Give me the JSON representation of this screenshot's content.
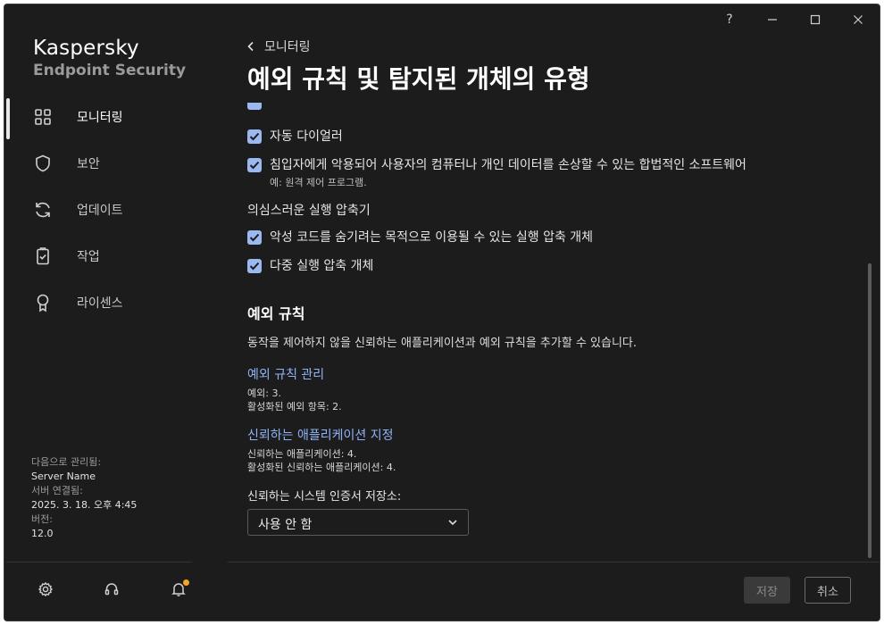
{
  "app": {
    "brand_line1": "Kaspersky",
    "brand_line2": "Endpoint Security"
  },
  "window_controls": {
    "help": "?",
    "icons": [
      "minimize-icon",
      "maximize-icon",
      "close-icon"
    ]
  },
  "sidebar": {
    "items": [
      {
        "label": "모니터링",
        "icon": "dashboard-icon",
        "active": true
      },
      {
        "label": "보안",
        "icon": "shield-icon",
        "active": false
      },
      {
        "label": "업데이트",
        "icon": "refresh-icon",
        "active": false
      },
      {
        "label": "작업",
        "icon": "clipboard-check-icon",
        "active": false
      },
      {
        "label": "라이센스",
        "icon": "award-icon",
        "active": false
      }
    ],
    "meta": {
      "managed_by_label": "다음으로 관리됨:",
      "managed_by_value": "Server Name",
      "connected_label": "서버 연결됨:",
      "connected_value": "2025. 3. 18. 오후 4:45",
      "version_label": "버전:",
      "version_value": "12.0"
    },
    "bottom_icons": [
      "settings-icon",
      "headset-icon",
      "bell-icon"
    ]
  },
  "header": {
    "back_label": "모니터링",
    "title": "예외 규칙 및 탐지된 개체의 유형"
  },
  "content": {
    "checkboxes_top": [
      {
        "label": "자동 다이얼러",
        "checked": true,
        "sub": ""
      },
      {
        "label": "침입자에게 악용되어 사용자의 컴퓨터나 개인 데이터를 손상할 수 있는 합법적인 소프트웨어",
        "checked": true,
        "sub": "예: 원격 제어 프로그램."
      }
    ],
    "packers_group": {
      "heading": "의심스러운 실행 압축기",
      "items": [
        {
          "label": "악성 코드를 숨기려는 목적으로 이용될 수 있는 실행 압축 개체",
          "checked": true
        },
        {
          "label": "다중 실행 압축 개체",
          "checked": true
        }
      ]
    },
    "exclusions": {
      "heading": "예외 규칙",
      "description": "동작을 제어하지 않을 신뢰하는 애플리케이션과 예외 규칙을 추가할 수 있습니다.",
      "manage_link": "예외 규칙 관리",
      "exclusions_count": "예외: 3.",
      "active_exclusions": "활성화된 예외 항목: 2.",
      "trusted_link": "신뢰하는 애플리케이션 지정",
      "trusted_count": "신뢰하는 애플리케이션: 4.",
      "active_trusted": "활성화된 신뢰하는 애플리케이션: 4."
    },
    "cert_store": {
      "label": "신뢰하는 시스템 인증서 저장소:",
      "selected": "사용 안 함"
    }
  },
  "footer": {
    "save_label": "저장",
    "cancel_label": "취소"
  },
  "colors": {
    "background": "#1c1c1c",
    "checkbox": "#9bb8f0",
    "link": "#8fb3f5",
    "notification": "#f5a623"
  }
}
